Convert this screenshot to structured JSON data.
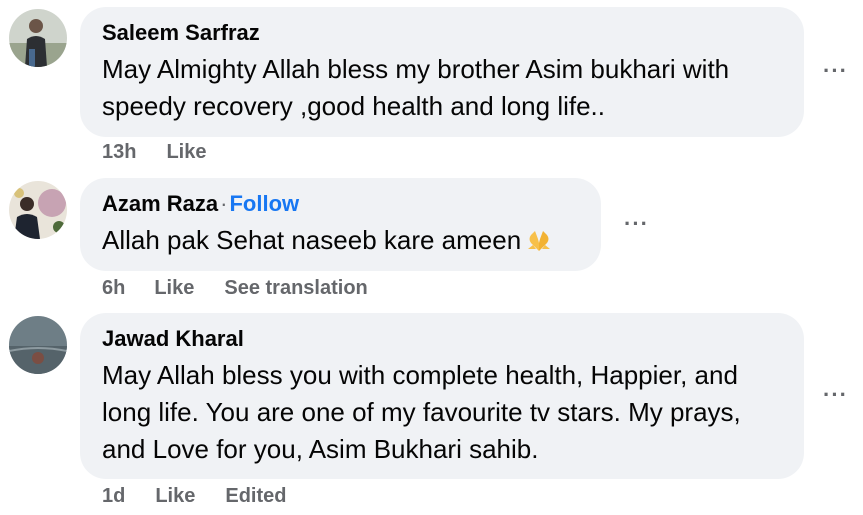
{
  "comments": [
    {
      "author": "Saleem Sarfraz",
      "text_lines": [
        "May Almighty Allah bless my brother Asim bukhari with",
        "speedy recovery ,good health and long life.."
      ],
      "time": "13h",
      "like_label": "Like",
      "avatar_icon": "user-photo-icon"
    },
    {
      "author": "Azam Raza",
      "separator": "·",
      "follow_label": "Follow",
      "text_lines": [
        "Allah pak Sehat naseeb kare ameen"
      ],
      "emoji": "praying-hands-emoji",
      "time": "6h",
      "like_label": "Like",
      "translation_label": "See translation",
      "avatar_icon": "user-photo-icon"
    },
    {
      "author": "Jawad Kharal",
      "text_lines": [
        "May Allah bless you with complete health, Happier, and",
        "long life. You are one of my favourite tv stars. My prays,",
        "and Love for you, Asim Bukhari sahib."
      ],
      "time": "1d",
      "like_label": "Like",
      "edited_label": "Edited",
      "avatar_icon": "user-photo-icon"
    }
  ],
  "more_options_label": "···",
  "colors": {
    "bubble": "#f0f2f5",
    "meta_text": "#65676b",
    "follow": "#1877f2"
  }
}
